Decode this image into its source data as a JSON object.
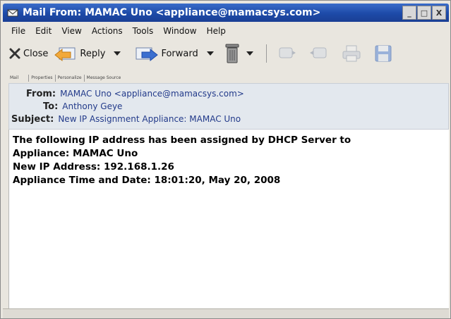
{
  "window": {
    "title": "Mail From: MAMAC Uno <appliance@mamacsys.com>",
    "minimize": "_",
    "maximize": "□",
    "close": "X"
  },
  "menu": [
    "File",
    "Edit",
    "View",
    "Actions",
    "Tools",
    "Window",
    "Help"
  ],
  "toolbar": {
    "close_label": "Close",
    "reply_label": "Reply",
    "forward_label": "Forward"
  },
  "tabs": [
    "Mail",
    "Properties",
    "Personalize",
    "Message Source"
  ],
  "header": {
    "from_label": "From:",
    "from_value": "MAMAC Uno <appliance@mamacsys.com>",
    "to_label": "To:",
    "to_value": "Anthony Geye",
    "subject_label": "Subject:",
    "subject_value": "New IP  Assignment Appliance: MAMAC Uno"
  },
  "body": {
    "lines": [
      "The following IP address has been assigned by DHCP Server to",
      "Appliance: MAMAC Uno",
      "New IP Address: 192.168.1.26",
      "Appliance Time and Date: 18:01:20, May 20, 2008"
    ]
  }
}
